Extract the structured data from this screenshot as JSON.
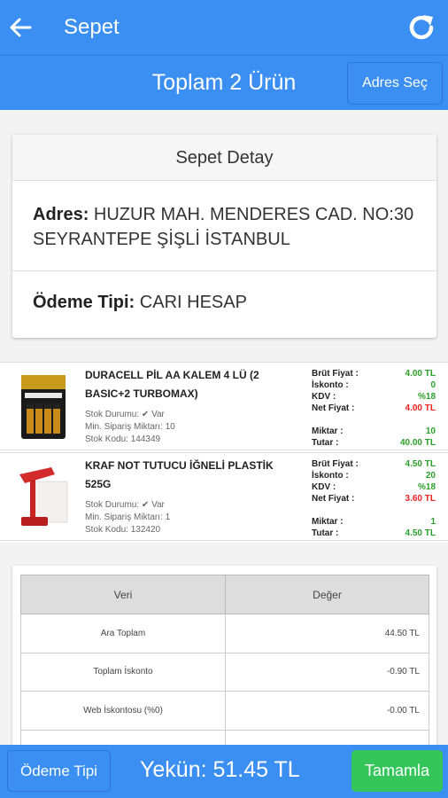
{
  "appbar": {
    "title": "Sepet",
    "back_icon": "arrow-left-icon",
    "refresh_icon": "refresh-icon"
  },
  "subbar": {
    "total_text": "Toplam 2 Ürün",
    "address_button": "Adres Seç"
  },
  "detail": {
    "header": "Sepet Detay",
    "address_label": "Adres:",
    "address_value": "HUZUR MAH. MENDERES CAD. NO:30 SEYRANTEPE ŞİŞLİ İSTANBUL",
    "payment_label": "Ödeme Tipi:",
    "payment_value": "CARI HESAP"
  },
  "products": [
    {
      "name": "DURACELL PİL AA KALEM 4 LÜ (2 BASIC+2 TURBOMAX)",
      "stock_status": "Stok Durumu: ✔ Var",
      "min_order": "Min. Sipariş Miktarı: 10",
      "stock_code": "Stok Kodu: 144349",
      "gross_label": "Brüt Fiyat :",
      "gross_value": "4.00 TL",
      "discount_label": "İskonto :",
      "discount_value": "0",
      "vat_label": "KDV :",
      "vat_value": "%18",
      "net_label": "Net Fiyat :",
      "net_value": "4.00 TL",
      "qty_label": "Miktar :",
      "qty_value": "10",
      "total_label": "Tutar :",
      "total_value": "40.00 TL"
    },
    {
      "name": "KRAF NOT TUTUCU İĞNELİ PLASTİK 525G",
      "stock_status": "Stok Durumu: ✔ Var",
      "min_order": "Min. Sipariş Miktarı: 1",
      "stock_code": "Stok Kodu: 132420",
      "gross_label": "Brüt Fiyat :",
      "gross_value": "4.50 TL",
      "discount_label": "İskonto :",
      "discount_value": "20",
      "vat_label": "KDV :",
      "vat_value": "%18",
      "net_label": "Net Fiyat :",
      "net_value": "3.60 TL",
      "qty_label": "Miktar :",
      "qty_value": "1",
      "total_label": "Tutar :",
      "total_value": "4.50 TL"
    }
  ],
  "summary": {
    "col1": "Veri",
    "col2": "Değer",
    "rows": [
      {
        "label": "Ara Toplam",
        "value": "44.50 TL"
      },
      {
        "label": "Toplam İskonto",
        "value": "-0.90 TL"
      },
      {
        "label": "Web İskontosu (%0)",
        "value": "-0.00 TL"
      }
    ]
  },
  "bottom": {
    "payment_button": "Ödeme Tipi",
    "total_text": "Yekün: 51.45 TL",
    "complete_button": "Tamamla"
  },
  "colors": {
    "primary": "#3b8ff2",
    "success": "#34c65a",
    "price_green": "#2aa02a",
    "price_red": "#e22222"
  }
}
